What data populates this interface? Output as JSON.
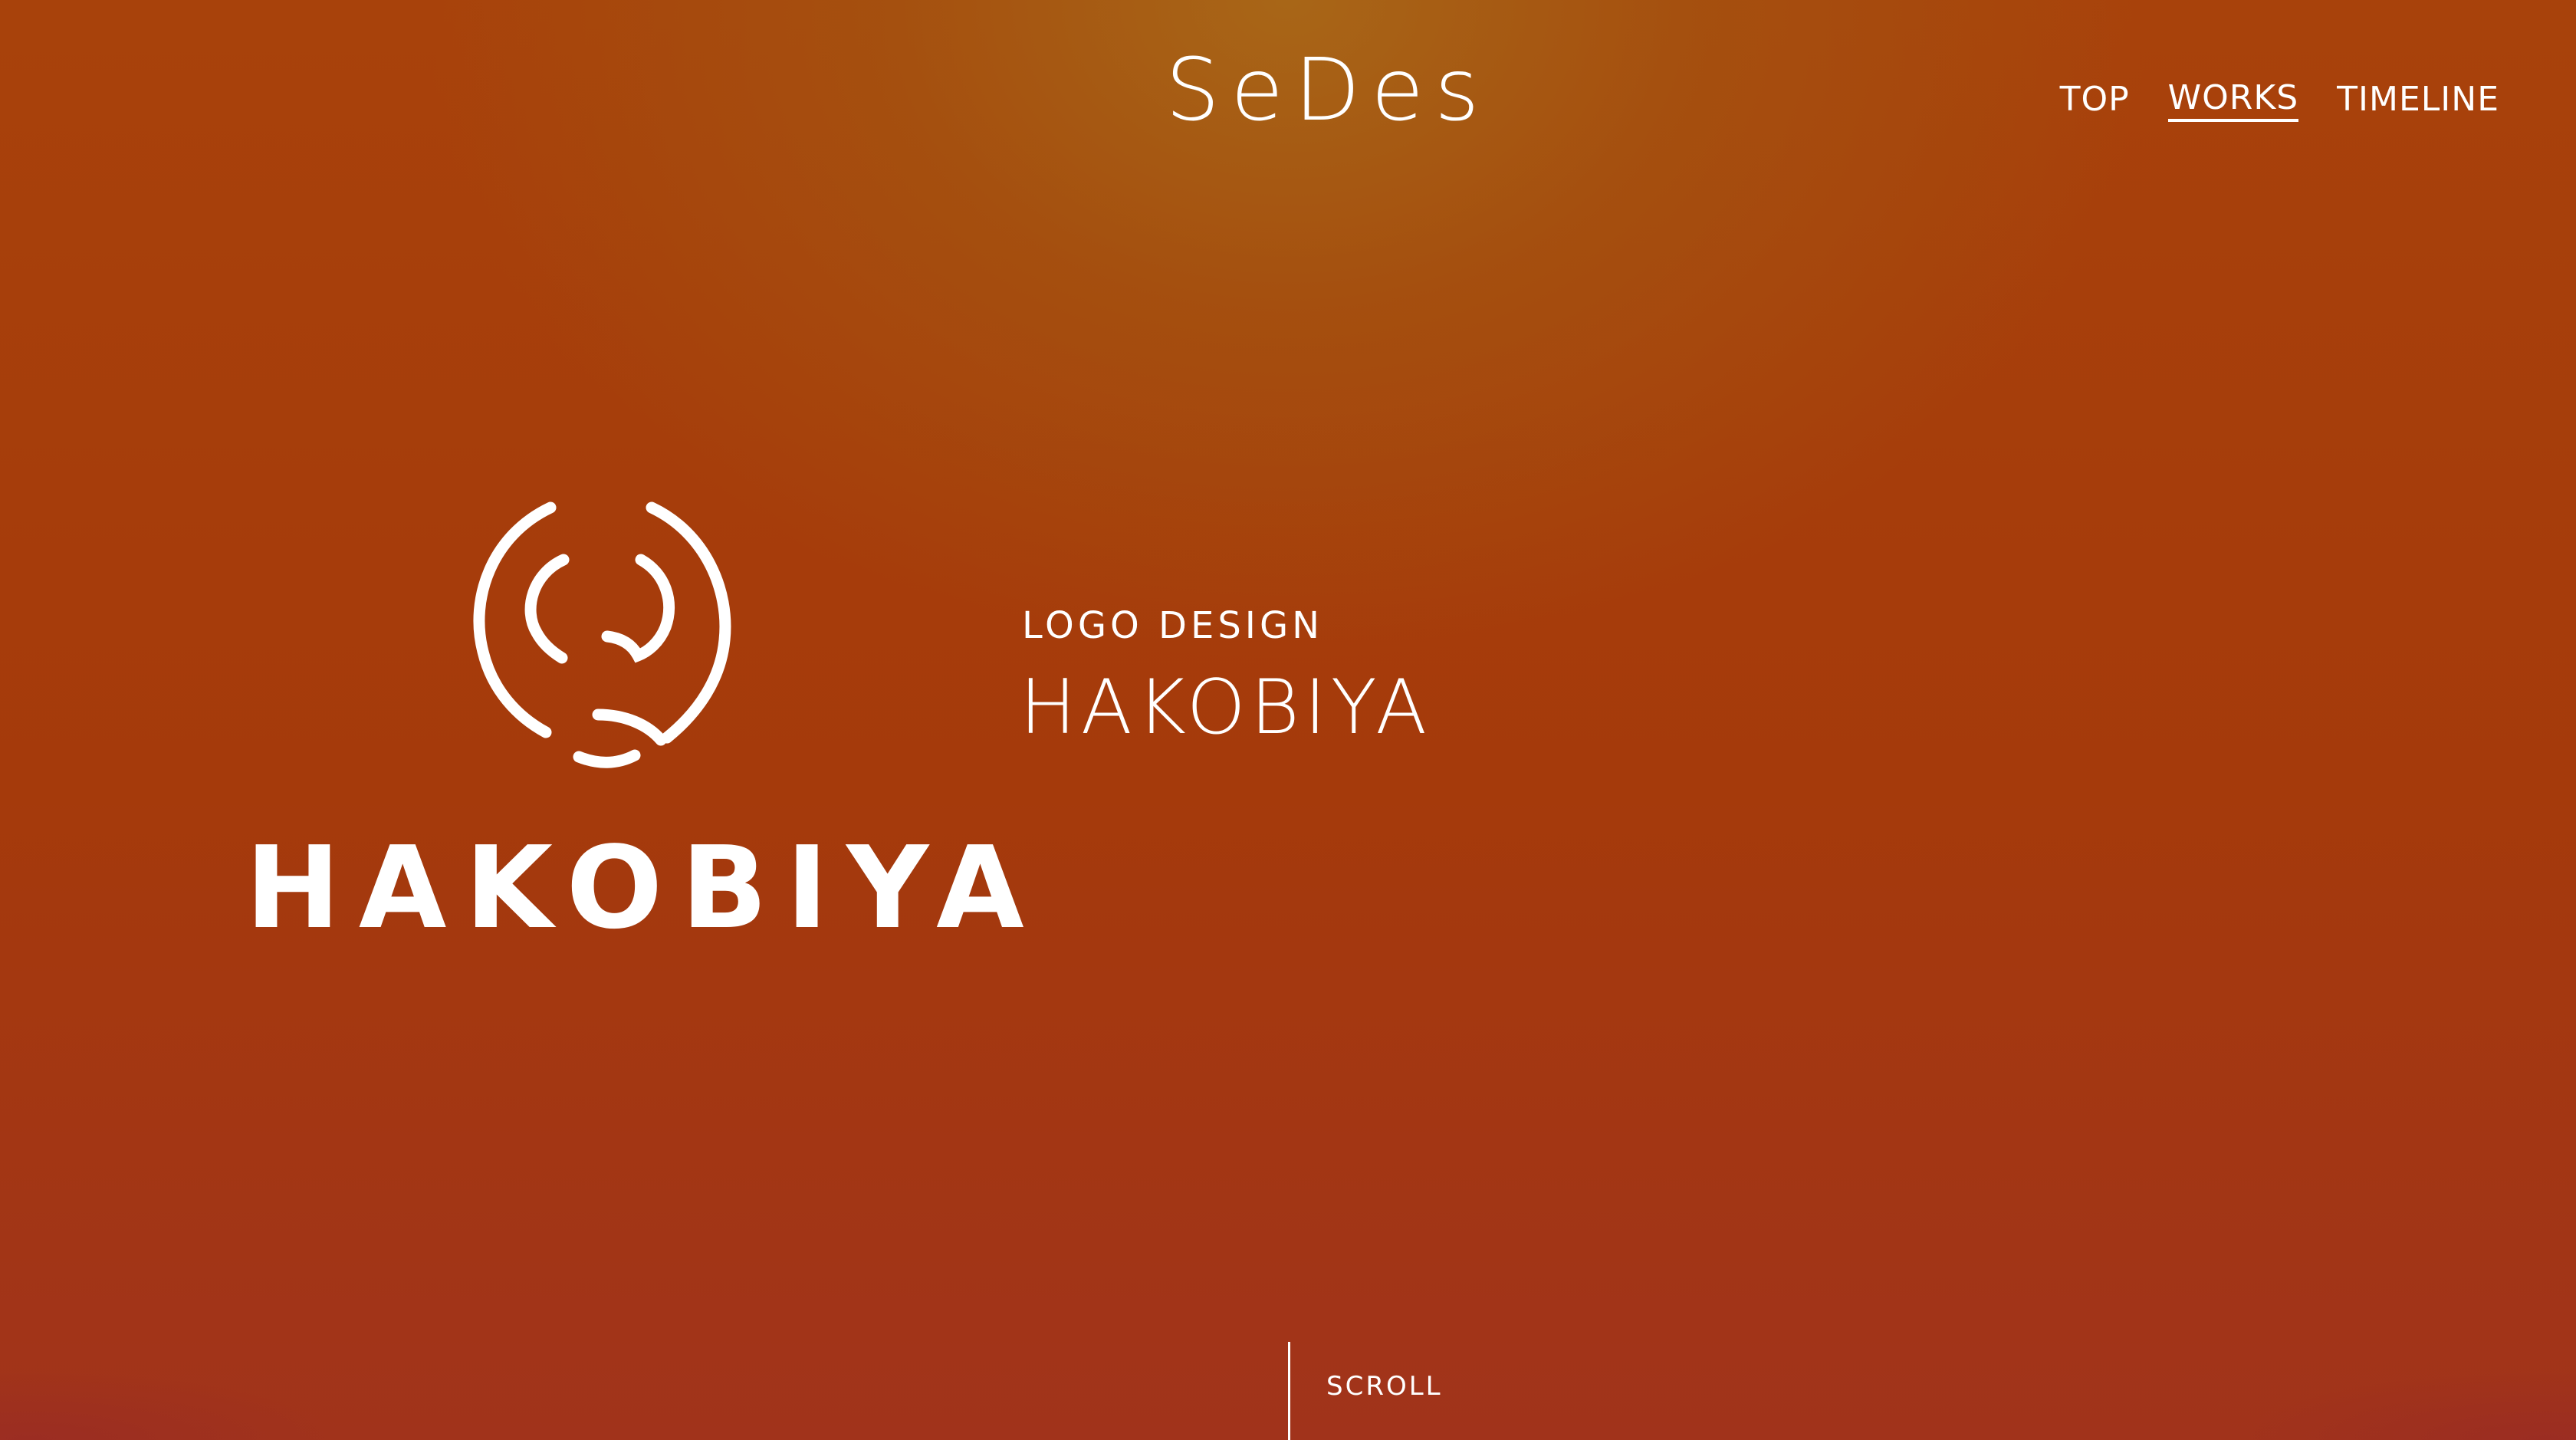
{
  "header": {
    "brand": "SeDes",
    "nav": {
      "top": "TOP",
      "works": "WORKS",
      "timeline": "TIMELINE",
      "active": "WORKS"
    }
  },
  "hero": {
    "logo_wordmark": "HAKOBIYA",
    "category": "LOGO DESIGN",
    "title": "HAKOBIYA"
  },
  "scroll": {
    "label": "SCROLL"
  },
  "colors": {
    "background_top": "#a8641a",
    "background_main": "#a53a0b",
    "text": "#ffffff"
  }
}
